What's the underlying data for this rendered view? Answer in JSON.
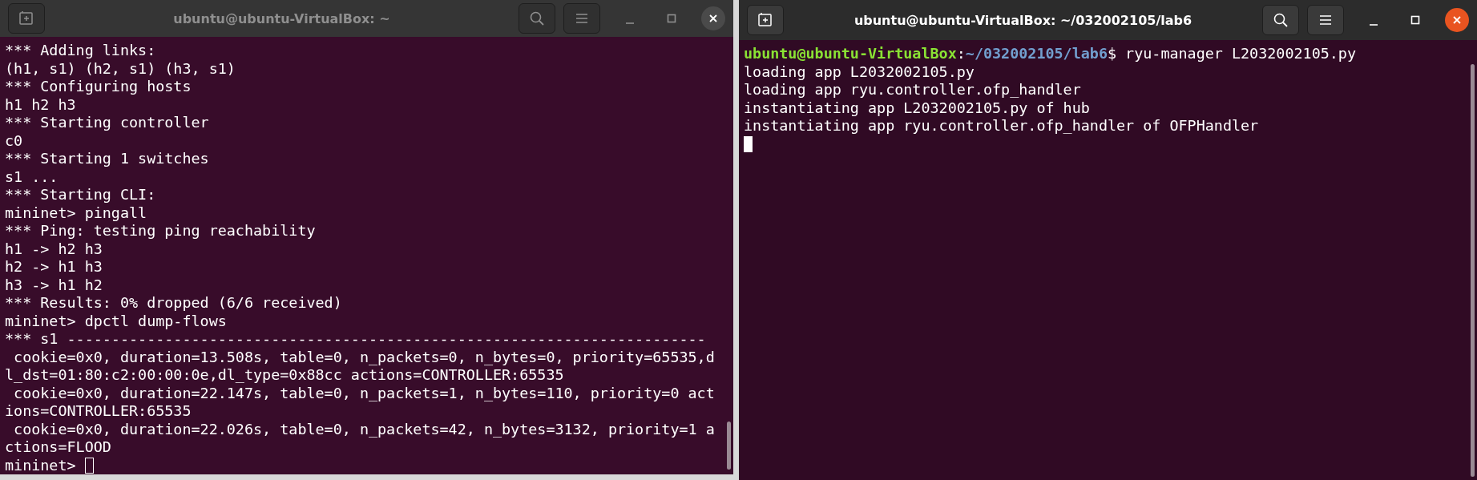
{
  "windows": [
    {
      "title": "ubuntu@ubuntu-VirtualBox: ~",
      "focused": false,
      "lines": [
        {
          "kind": "text",
          "text": "*** Adding links:"
        },
        {
          "kind": "text",
          "text": "(h1, s1) (h2, s1) (h3, s1)"
        },
        {
          "kind": "text",
          "text": "*** Configuring hosts"
        },
        {
          "kind": "text",
          "text": "h1 h2 h3"
        },
        {
          "kind": "text",
          "text": "*** Starting controller"
        },
        {
          "kind": "text",
          "text": "c0"
        },
        {
          "kind": "text",
          "text": "*** Starting 1 switches"
        },
        {
          "kind": "text",
          "text": "s1 ..."
        },
        {
          "kind": "text",
          "text": "*** Starting CLI:"
        },
        {
          "kind": "text",
          "text": "mininet> pingall"
        },
        {
          "kind": "text",
          "text": "*** Ping: testing ping reachability"
        },
        {
          "kind": "text",
          "text": "h1 -> h2 h3"
        },
        {
          "kind": "text",
          "text": "h2 -> h1 h3"
        },
        {
          "kind": "text",
          "text": "h3 -> h1 h2"
        },
        {
          "kind": "text",
          "text": "*** Results: 0% dropped (6/6 received)"
        },
        {
          "kind": "text",
          "text": "mininet> dpctl dump-flows"
        },
        {
          "kind": "text",
          "text": "*** s1 ------------------------------------------------------------------------"
        },
        {
          "kind": "text",
          "text": " cookie=0x0, duration=13.508s, table=0, n_packets=0, n_bytes=0, priority=65535,d"
        },
        {
          "kind": "text",
          "text": "l_dst=01:80:c2:00:00:0e,dl_type=0x88cc actions=CONTROLLER:65535"
        },
        {
          "kind": "text",
          "text": " cookie=0x0, duration=22.147s, table=0, n_packets=1, n_bytes=110, priority=0 act"
        },
        {
          "kind": "text",
          "text": "ions=CONTROLLER:65535"
        },
        {
          "kind": "text",
          "text": " cookie=0x0, duration=22.026s, table=0, n_packets=42, n_bytes=3132, priority=1 a"
        },
        {
          "kind": "text",
          "text": "ctions=FLOOD"
        },
        {
          "kind": "input",
          "text": "mininet> "
        }
      ]
    },
    {
      "title": "ubuntu@ubuntu-VirtualBox: ~/032002105/lab6",
      "focused": true,
      "lines": [
        {
          "kind": "prompt",
          "user": "ubuntu@ubuntu-VirtualBox",
          "sep": ":",
          "path": "~/032002105/lab6",
          "command": "$ ryu-manager L2032002105.py"
        },
        {
          "kind": "text",
          "text": "loading app L2032002105.py"
        },
        {
          "kind": "text",
          "text": "loading app ryu.controller.ofp_handler"
        },
        {
          "kind": "text",
          "text": "instantiating app L2032002105.py of hub"
        },
        {
          "kind": "text",
          "text": "instantiating app ryu.controller.ofp_handler of OFPHandler"
        },
        {
          "kind": "input"
        }
      ]
    }
  ]
}
